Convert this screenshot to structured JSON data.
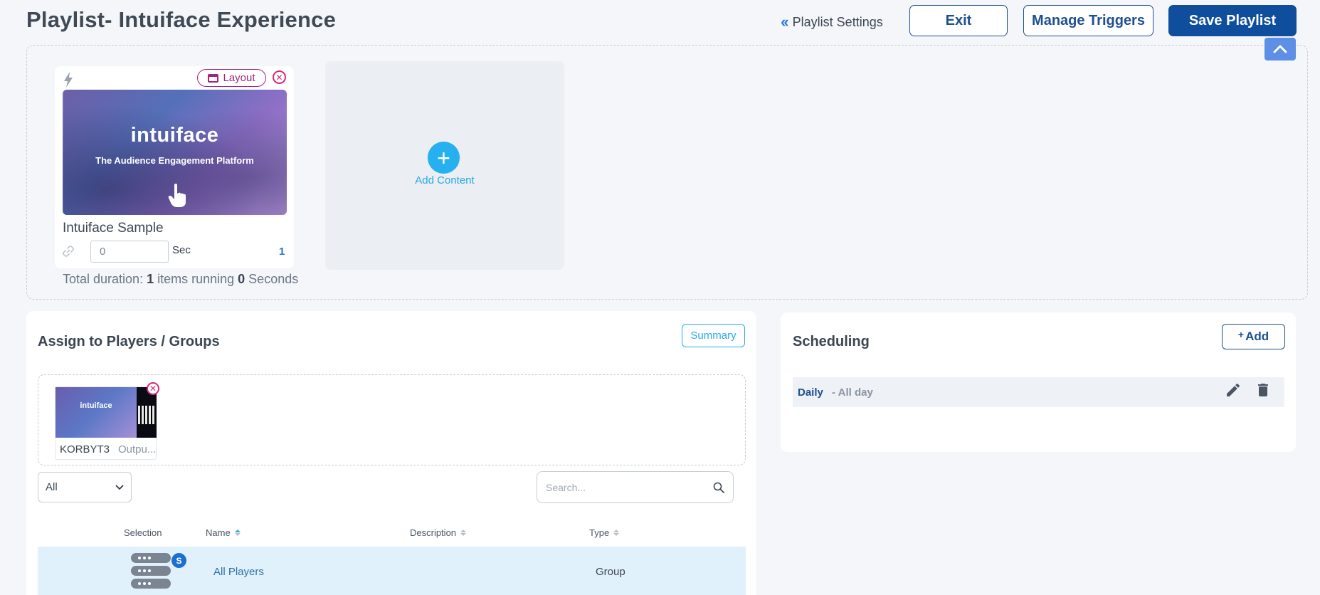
{
  "header": {
    "title": "Playlist- Intuiface Experience",
    "settings_label": "Playlist Settings",
    "exit_label": "Exit",
    "triggers_label": "Manage Triggers",
    "save_label": "Save Playlist"
  },
  "playlist": {
    "item": {
      "layout_label": "Layout",
      "thumb_logo": "intuiface",
      "thumb_tagline": "The Audience Engagement Platform",
      "name": "Intuiface Sample",
      "duration_value": "0",
      "duration_unit": "Sec",
      "order": "1"
    },
    "add_content_label": "Add Content",
    "total": {
      "prefix": "Total duration: ",
      "items": "1",
      "middle": " items running ",
      "seconds": "0",
      "suffix": " Seconds"
    }
  },
  "assign": {
    "title": "Assign to Players / Groups",
    "summary_label": "Summary",
    "assigned_player": {
      "thumb_logo": "intuiface",
      "name": "KORBYT3",
      "description": "Outpu..."
    },
    "filter_value": "All",
    "search_placeholder": "Search...",
    "columns": {
      "selection": "Selection",
      "name": "Name",
      "description": "Description",
      "type": "Type"
    },
    "rows": [
      {
        "badge": "S",
        "name": "All Players",
        "description": "",
        "type": "Group"
      }
    ]
  },
  "scheduling": {
    "title": "Scheduling",
    "add_label": "Add",
    "add_plus": "+",
    "entries": [
      {
        "frequency": "Daily",
        "time": "- All day"
      }
    ]
  },
  "colors": {
    "primary": "#0f4e9c",
    "accent": "#28a9e8",
    "layout_badge": "#a3237d",
    "remove": "#d32a7c"
  }
}
